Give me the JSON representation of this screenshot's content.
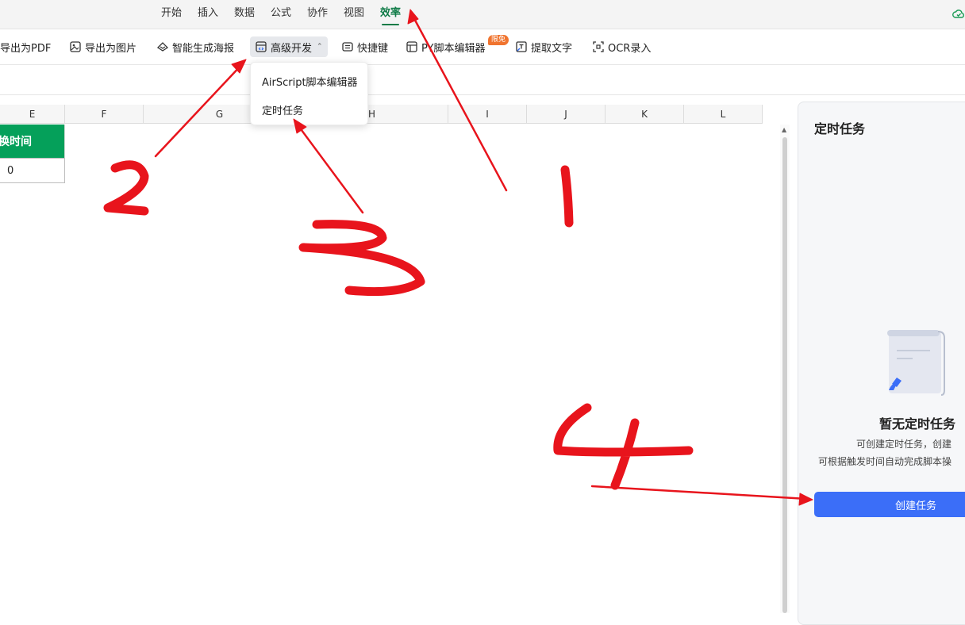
{
  "menubar": {
    "items": [
      "开始",
      "插入",
      "数据",
      "公式",
      "协作",
      "视图",
      "效率"
    ],
    "active": "效率"
  },
  "toolbar": {
    "export_pdf": "导出为PDF",
    "export_image": "导出为图片",
    "smart_poster": "智能生成海报",
    "advanced_dev": "高级开发",
    "shortcuts": "快捷键",
    "script_editor": "PY脚本编辑器",
    "script_badge": "限免",
    "extract_text": "提取文字",
    "ocr_input": "OCR录入"
  },
  "dropdown": {
    "items": [
      "AirScript脚本编辑器",
      "定时任务"
    ]
  },
  "sheet": {
    "columns": [
      "E",
      "F",
      "G",
      "H",
      "I",
      "J",
      "K",
      "L"
    ],
    "header_cell": "换时间",
    "value_cell": "0"
  },
  "panel": {
    "title": "定时任务",
    "empty_title": "暂无定时任务",
    "empty_desc_line1": "可创建定时任务，创建",
    "empty_desc_line2": "可根据触发时间自动完成脚本操",
    "create_button": "创建任务"
  },
  "annotations": {
    "step1": "1",
    "step2": "2",
    "step3": "3",
    "step4": "4",
    "color": "#e8141c"
  },
  "colors": {
    "accent_green": "#0f7b47",
    "header_cell_green": "#05a05a",
    "primary_button": "#3b6ef8",
    "badge_orange": "#f0742f"
  }
}
